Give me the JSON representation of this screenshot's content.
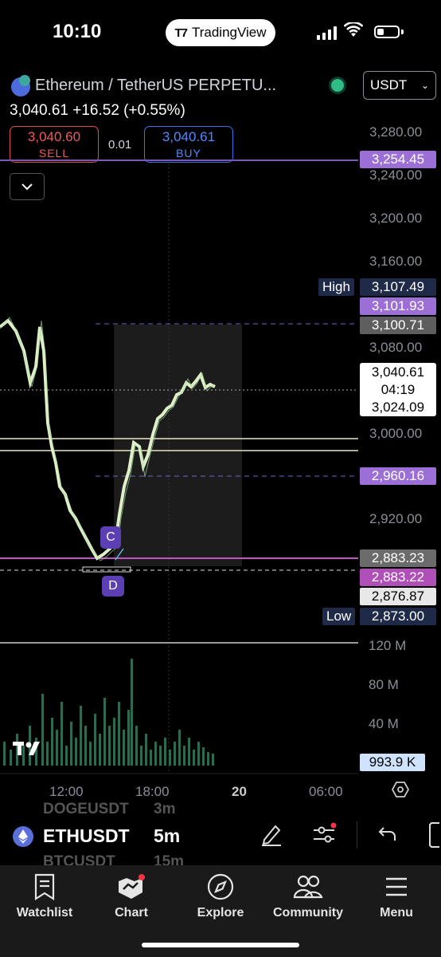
{
  "status_bar": {
    "time": "10:10",
    "app_pill": "TradingView"
  },
  "header": {
    "symbol_title": "Ethereum / TetherUS PERPETU...",
    "price_line": "3,040.61 +16.52 (+0.55%)",
    "currency": "USDT",
    "sell_price": "3,040.60",
    "sell_label": "SELL",
    "spread": "0.01",
    "buy_price": "3,040.61",
    "buy_label": "BUY"
  },
  "price_axis": [
    "3,280.00",
    "3,240.00",
    "3,200.00",
    "3,160.00",
    "3,080.00",
    "3,000.00",
    "2,920.00"
  ],
  "price_tags": {
    "t3254": "3,254.45",
    "high_label": "High",
    "high": "3,107.49",
    "t3101": "3,101.93",
    "t3100": "3,100.71",
    "last": "3,040.61",
    "countdown": "04:19",
    "t3024": "3,024.09",
    "t2960": "2,960.16",
    "t2883a": "2,883.23",
    "t2883b": "2,883.22",
    "t2876": "2,876.87",
    "low_label": "Low",
    "low": "2,873.00"
  },
  "volume_axis": [
    "120 M",
    "80 M",
    "40 M"
  ],
  "volume_tag": "993.9 K",
  "time_axis": [
    "12:00",
    "18:00",
    "20",
    "06:00"
  ],
  "markers": {
    "c": "C",
    "d": "D"
  },
  "symbol_bar": {
    "symbol": "ETHUSDT",
    "timeframe": "5m",
    "ghost_top_symbol": "DOGEUSDT",
    "ghost_top_tf": "3m",
    "ghost_bottom_symbol": "BTCUSDT",
    "ghost_bottom_tf": "15m"
  },
  "nav": [
    {
      "label": "Watchlist",
      "icon": "watchlist-icon"
    },
    {
      "label": "Chart",
      "icon": "chart-icon"
    },
    {
      "label": "Explore",
      "icon": "compass-icon"
    },
    {
      "label": "Community",
      "icon": "community-icon"
    },
    {
      "label": "Menu",
      "icon": "menu-icon"
    }
  ],
  "colors": {
    "purple": "#9b6fd6",
    "up": "#dff0c8",
    "sell": "#e04b4b",
    "buy": "#3c6fe8"
  }
}
